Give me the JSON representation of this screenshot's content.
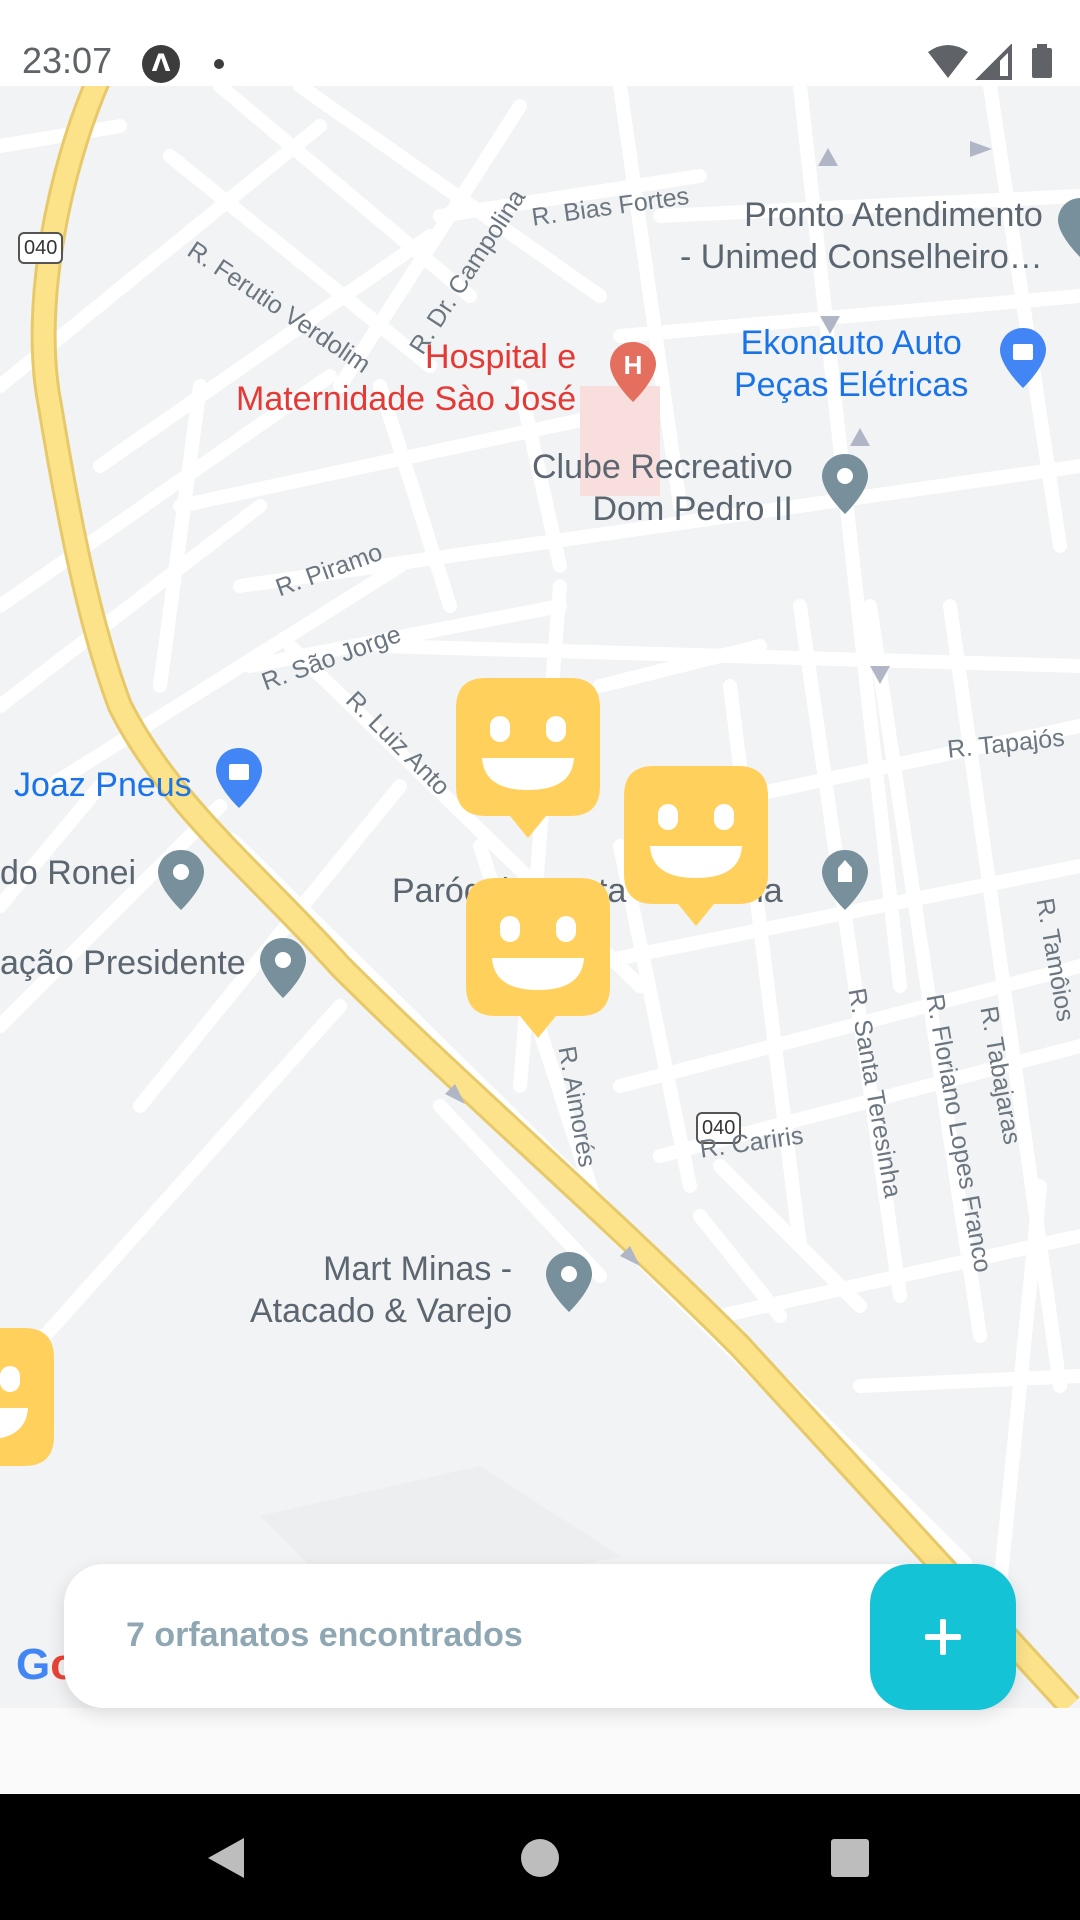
{
  "status_bar": {
    "time": "23:07",
    "app_badge": "ᐱ",
    "icons": [
      "wifi-icon",
      "signal-icon",
      "battery-icon"
    ]
  },
  "map": {
    "places": {
      "pronto": "Pronto Atendimento\n- Unimed Conselheiro…",
      "hospital": "Hospital e\nMaternidade Sào José",
      "ekonauto": "Ekonauto Auto\nPeças Elétricas",
      "clube": "Clube Recreativo\nDom Pedro II",
      "joaz": "Joaz Pneus",
      "ronei": "do Ronei",
      "presidente": "ação Presidente",
      "paroquia": "Paróquia Santa Teresinha",
      "mart": "Mart Minas -\nAtacado & Varejo"
    },
    "streets": {
      "bias_fortes": "R. Bias Fortes",
      "ferutio": "R. Ferutio Verdolim",
      "campolina": "R. Dr. Campolina",
      "piramo": "R. Piramo",
      "sao_jorge": "R. São Jorge",
      "luiz_antonio": "R. Luiz Anto",
      "tapajos": "R. Tapajós",
      "tamoios": "R. Tamôios",
      "aimores": "R. Aimorés",
      "santa_teresinha": "R. Santa Teresinha",
      "floriano": "R. Floriano Lopes Franco",
      "tabajaras": "R. Tabajaras",
      "cariris": "R. Cariris"
    },
    "highway_number": "040",
    "colors": {
      "background": "#f1f3f4",
      "road": "#ffffff",
      "highway": "#fce38a",
      "marker": "#ffd15c",
      "poi_blue": "#1a73e8",
      "poi_gray": "#78909c",
      "hospital": "#e53935"
    }
  },
  "footer": {
    "found_text": "7 orfanatos encontrados",
    "create_icon": "plus-icon",
    "accent": "#15c3d6"
  },
  "google_logo": "Go",
  "nav_bar": {
    "icons": [
      "back-triangle-icon",
      "home-circle-icon",
      "recents-square-icon"
    ]
  }
}
